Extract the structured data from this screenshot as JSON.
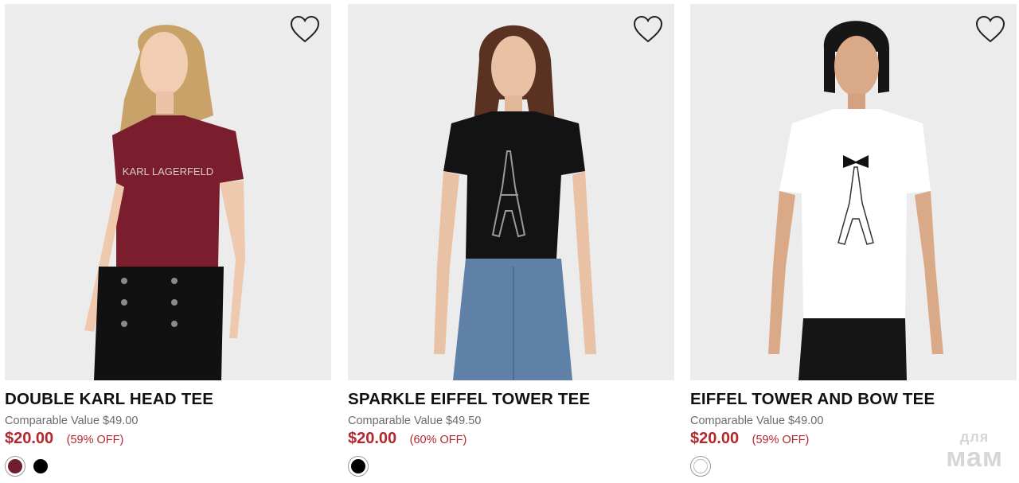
{
  "products": [
    {
      "name": "DOUBLE KARL HEAD TEE",
      "comparable": "Comparable Value $49.00",
      "price": "$20.00",
      "discount": "(59% OFF)",
      "swatches": [
        {
          "color": "#6e1e2e",
          "selected": true
        },
        {
          "color": "#000000",
          "selected": false
        }
      ]
    },
    {
      "name": "SPARKLE EIFFEL TOWER TEE",
      "comparable": "Comparable Value $49.50",
      "price": "$20.00",
      "discount": "(60% OFF)",
      "swatches": [
        {
          "color": "#000000",
          "selected": true
        }
      ]
    },
    {
      "name": "EIFFEL TOWER AND BOW TEE",
      "comparable": "Comparable Value $49.00",
      "price": "$20.00",
      "discount": "(59% OFF)",
      "swatches": [
        {
          "color": "#ffffff",
          "selected": true
        }
      ]
    }
  ],
  "watermark": {
    "line1": "для",
    "line2": "мам"
  },
  "icons": {
    "wishlist": "heart-outline-icon"
  },
  "colors": {
    "price": "#b3282d",
    "photo_bg": "#ececec"
  }
}
